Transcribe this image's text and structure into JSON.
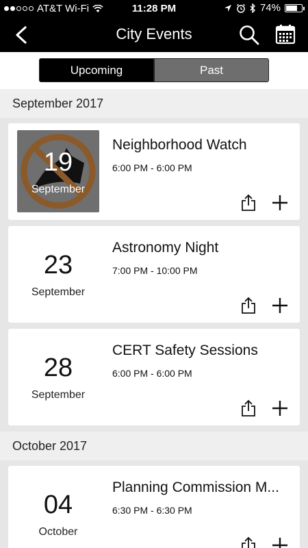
{
  "status_bar": {
    "carrier": "AT&T Wi-Fi",
    "time": "11:28 PM",
    "battery": "74%",
    "battery_level": 0.74,
    "signal_bars_filled": 2,
    "signal_bars_total": 5
  },
  "nav": {
    "title": "City Events",
    "back_icon": "chevron-left-icon",
    "search_icon": "search-icon",
    "calendar_icon": "calendar-icon"
  },
  "tabs": [
    {
      "label": "Upcoming",
      "selected": true
    },
    {
      "label": "Past",
      "selected": false
    }
  ],
  "sections": [
    {
      "header": "September 2017",
      "events": [
        {
          "day": "19",
          "month": "September",
          "title": "Neighborhood Watch",
          "time": "6:00 PM - 6:00 PM",
          "has_image": true
        },
        {
          "day": "23",
          "month": "September",
          "title": "Astronomy Night",
          "time": "7:00 PM - 10:00 PM",
          "has_image": false
        },
        {
          "day": "28",
          "month": "September",
          "title": "CERT Safety Sessions",
          "time": "6:00 PM - 6:00 PM",
          "has_image": false
        }
      ]
    },
    {
      "header": "October 2017",
      "events": [
        {
          "day": "04",
          "month": "October",
          "title": "Planning Commission M...",
          "time": "6:30 PM - 6:30 PM",
          "has_image": false
        }
      ]
    }
  ],
  "colors": {
    "bar_background": "#000000",
    "segment_inactive": "#6e6e6e",
    "list_background": "#e6e6e6",
    "section_background": "#efefef",
    "no_watch_circle": "#8a5a2b"
  }
}
